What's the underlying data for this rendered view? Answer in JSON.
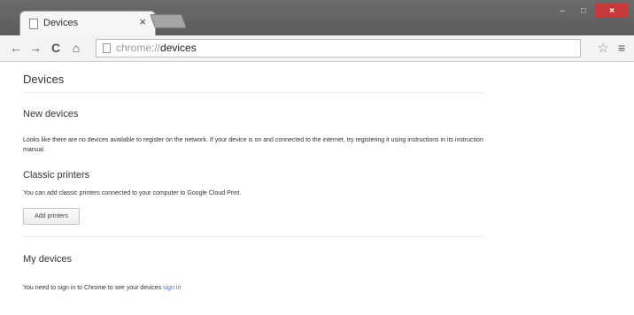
{
  "tab": {
    "title": "Devices",
    "close": "×"
  },
  "window_controls": {
    "minimize": "–",
    "maximize": "□",
    "close": "×"
  },
  "toolbar": {
    "back": "←",
    "forward": "→",
    "reload": "C",
    "home": "⌂",
    "url_scheme": "chrome://",
    "url_path": "devices",
    "star": "☆",
    "menu": "≡"
  },
  "page": {
    "title": "Devices",
    "new_devices": {
      "heading": "New devices",
      "text": "Looks like there are no devices available to register on the network. If your device is on and connected to the internet, try registering it using instructions in its instruction manual."
    },
    "classic_printers": {
      "heading": "Classic printers",
      "text": "You can add classic printers connected to your computer to Google Cloud Print.",
      "button": "Add printers"
    },
    "my_devices": {
      "heading": "My devices",
      "text_before": "You need to sign in to Chrome to see your devices",
      "link": "sign in"
    }
  }
}
